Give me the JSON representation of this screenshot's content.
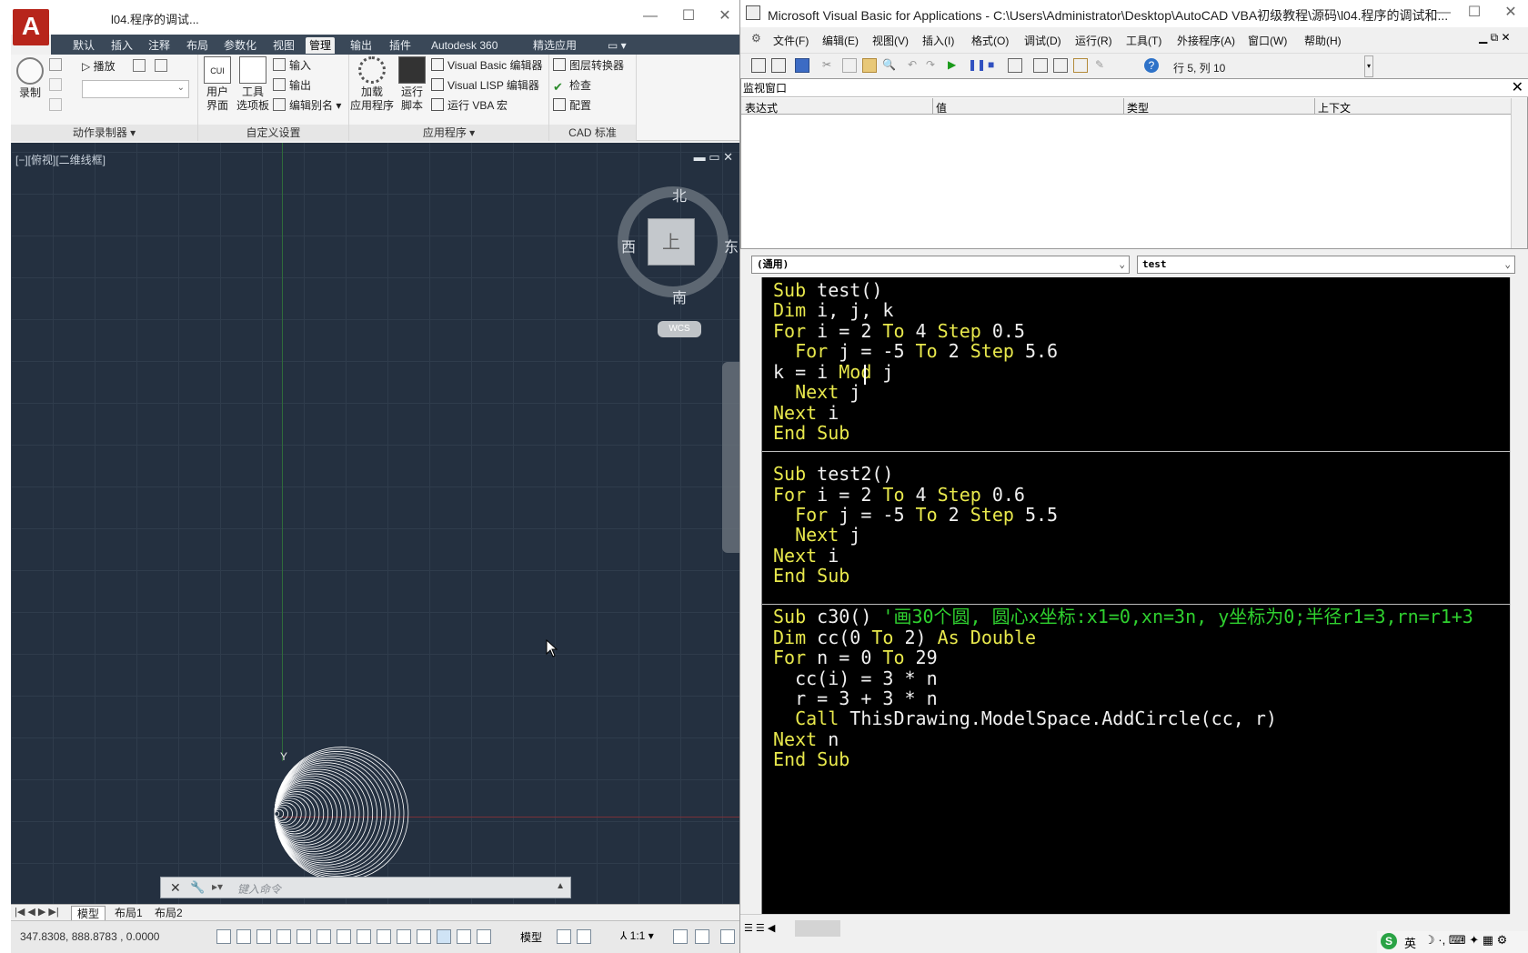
{
  "acad": {
    "title": "l04.程序的调试...",
    "ribbon_tabs": [
      "默认",
      "插入",
      "注释",
      "布局",
      "参数化",
      "视图",
      "管理",
      "输出",
      "插件",
      "Autodesk 360",
      "精选应用"
    ],
    "active_tab": "管理",
    "groups": {
      "macro_recorder": {
        "label": "动作录制器 ▾",
        "record": "录制",
        "play": "播放"
      },
      "customize": {
        "label": "自定义设置",
        "user_interface": "用户\n界面",
        "tool_palettes": "工具\n选项板",
        "import": "输入",
        "export": "输出",
        "edit_alias": "编辑别名 ▾"
      },
      "applications": {
        "label": "应用程序 ▾",
        "load_app": "加载\n应用程序",
        "run_script": "运行\n脚本",
        "vb_editor": "Visual Basic 编辑器",
        "lisp_editor": "Visual LISP 编辑器",
        "run_vba": "运行 VBA 宏"
      },
      "cad_standards": {
        "label": "CAD 标准",
        "layer_translator": "图层转换器",
        "check": "检查",
        "configure": "配置"
      }
    },
    "viewport_label": "[−][俯视][二维线框]",
    "viewcube": {
      "north": "北",
      "south": "南",
      "east": "东",
      "west": "西",
      "face": "上",
      "wcs": "WCS"
    },
    "command_placeholder": "键入命令",
    "layout_tabs": [
      "模型",
      "布局1",
      "布局2"
    ],
    "coords": "347.8308, 888.8783 , 0.0000",
    "status_model": "模型",
    "status_scale": "1:1"
  },
  "vba": {
    "title": "Microsoft Visual Basic for Applications - C:\\Users\\Administrator\\Desktop\\AutoCAD VBA初级教程\\源码\\l04.程序的调试和...",
    "menus": [
      "文件(F)",
      "编辑(E)",
      "视图(V)",
      "插入(I)",
      "格式(O)",
      "调试(D)",
      "运行(R)",
      "工具(T)",
      "外接程序(A)",
      "窗口(W)",
      "帮助(H)"
    ],
    "cursor_position": "行 5, 列 10",
    "watch_title": "监视窗口",
    "watch_columns": [
      "表达式",
      "值",
      "类型",
      "上下文"
    ],
    "object_combo": "(通用)",
    "proc_combo": "test",
    "code_lines": [
      "Sub test()",
      "Dim i, j, k",
      "For i = 2 To 4 Step 0.5",
      "  For j = -5 To 2 Step 5.6",
      "k = i Mod j",
      "  Next j",
      "Next i",
      "End Sub",
      "",
      "Sub test2()",
      "For i = 2 To 4 Step 0.6",
      "  For j = -5 To 2 Step 5.5",
      "  Next j",
      "Next i",
      "End Sub",
      "",
      "Sub c30() '画30个圆, 圆心x坐标:x1=0,xn=3n, y坐标为0;半径r1=3,rn=r1+3",
      "Dim cc(0 To 2) As Double",
      "For n = 0 To 29",
      "  cc(i) = 3 * n",
      "  r = 3 + 3 * n",
      "  Call ThisDrawing.ModelSpace.AddCircle(cc, r)",
      "Next n",
      "End Sub"
    ]
  },
  "tray": {
    "ime": "英"
  }
}
